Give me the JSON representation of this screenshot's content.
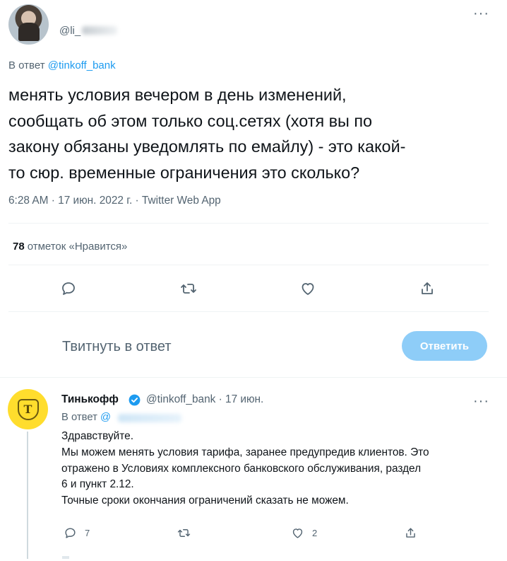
{
  "tweet": {
    "handle": "@li_",
    "reply_prefix": "В ответ",
    "reply_to": "@tinkoff_bank",
    "text": "менять условия вечером в день изменений,\nсообщать об этом только соц.сетях (хотя вы по\nзакону обязаны уведомлять по емайлу) - это какой-\nто сюр. временные ограничения это сколько?",
    "meta": "6:28 AM · 17 июн. 2022 г. · Twitter Web App",
    "likes_count": "78",
    "likes_label": "отметок «Нравится»"
  },
  "composer": {
    "placeholder": "Твитнуть в ответ",
    "reply_button": "Ответить"
  },
  "reply": {
    "name": "Тинькофф",
    "handle_time": "@tinkoff_bank · 17 июн.",
    "reply_prefix": "В ответ",
    "reply_to": "@",
    "avatar_glyph": "Т",
    "text": "Здравствуйте.\nМы можем менять условия тарифа, заранее предупредив клиентов. Это\nотражено в Условиях комплексного банковского обслуживания, раздел\n6 и пункт 2.12.\nТочные сроки окончания ограничений сказать не можем.",
    "reply_count": "7",
    "like_count": "2"
  },
  "icons": [
    "reply-icon",
    "retweet-icon",
    "like-icon",
    "share-icon",
    "more-icon",
    "verified-icon"
  ],
  "colors": {
    "accent": "#1d9bf0",
    "button_disabled": "#8ecdf8",
    "secondary_text": "#536471"
  }
}
